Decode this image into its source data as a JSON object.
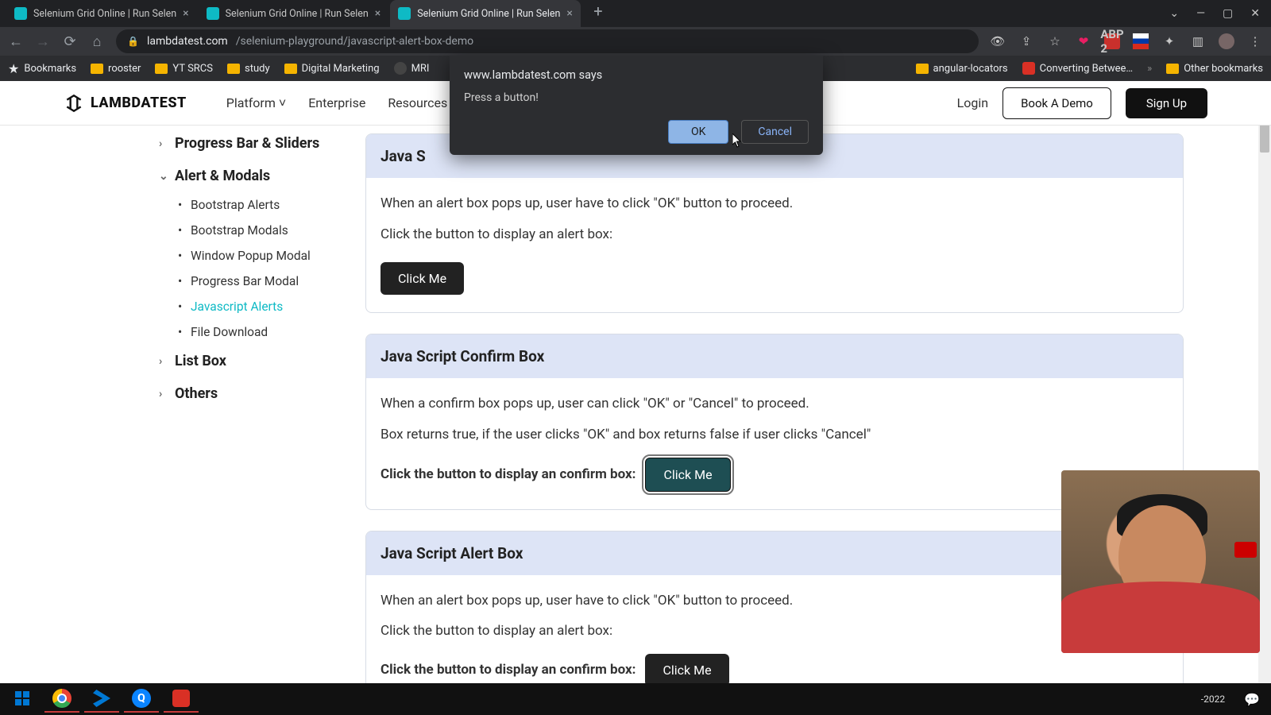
{
  "browser": {
    "tabs": [
      {
        "title": "Selenium Grid Online | Run Selen",
        "active": false
      },
      {
        "title": "Selenium Grid Online | Run Selen",
        "active": false
      },
      {
        "title": "Selenium Grid Online | Run Selen",
        "active": true
      }
    ],
    "url_host": "lambdatest.com",
    "url_path": "/selenium-playground/javascript-alert-box-demo",
    "bookmarks": {
      "main": "Bookmarks",
      "items": [
        "rooster",
        "YT SRCS",
        "study",
        "Digital Marketing",
        "MRI"
      ],
      "right_items": [
        "angular-locators",
        "Converting Betwee…"
      ],
      "other": "Other bookmarks"
    }
  },
  "dialog": {
    "origin": "www.lambdatest.com says",
    "message": "Press a button!",
    "ok": "OK",
    "cancel": "Cancel"
  },
  "header": {
    "logo": "LAMBDATEST",
    "nav": {
      "platform": "Platform",
      "enterprise": "Enterprise",
      "resources": "Resources"
    },
    "login": "Login",
    "book": "Book A Demo",
    "signup": "Sign Up"
  },
  "sidebar": {
    "groups": {
      "progress": "Progress Bar & Sliders",
      "alert": "Alert & Modals",
      "listbox": "List Box",
      "others": "Others"
    },
    "alert_items": [
      "Bootstrap Alerts",
      "Bootstrap Modals",
      "Window Popup Modal",
      "Progress Bar Modal",
      "Javascript Alerts",
      "File Download"
    ]
  },
  "cards": {
    "c1": {
      "title": "Java Script Alert Box",
      "title_truncated": "Java S",
      "p1": "When an alert box pops up, user have to click \"OK\" button to proceed.",
      "p2": "Click the button to display an alert box:",
      "btn": "Click Me"
    },
    "c2": {
      "title": "Java Script Confirm Box",
      "p1": "When a confirm box pops up, user can click \"OK\" or \"Cancel\" to proceed.",
      "p2": "Box returns true, if the user clicks \"OK\" and box returns false if user clicks \"Cancel\"",
      "prompt": "Click the button to display an confirm box:",
      "btn": "Click Me"
    },
    "c3": {
      "title": "Java Script Alert Box",
      "p1": "When an alert box pops up, user have to click \"OK\" button to proceed.",
      "p2": "Click the button to display an alert box:",
      "prompt": "Click the button to display an confirm box:",
      "btn": "Click Me"
    }
  },
  "taskbar": {
    "date": "-2022"
  }
}
